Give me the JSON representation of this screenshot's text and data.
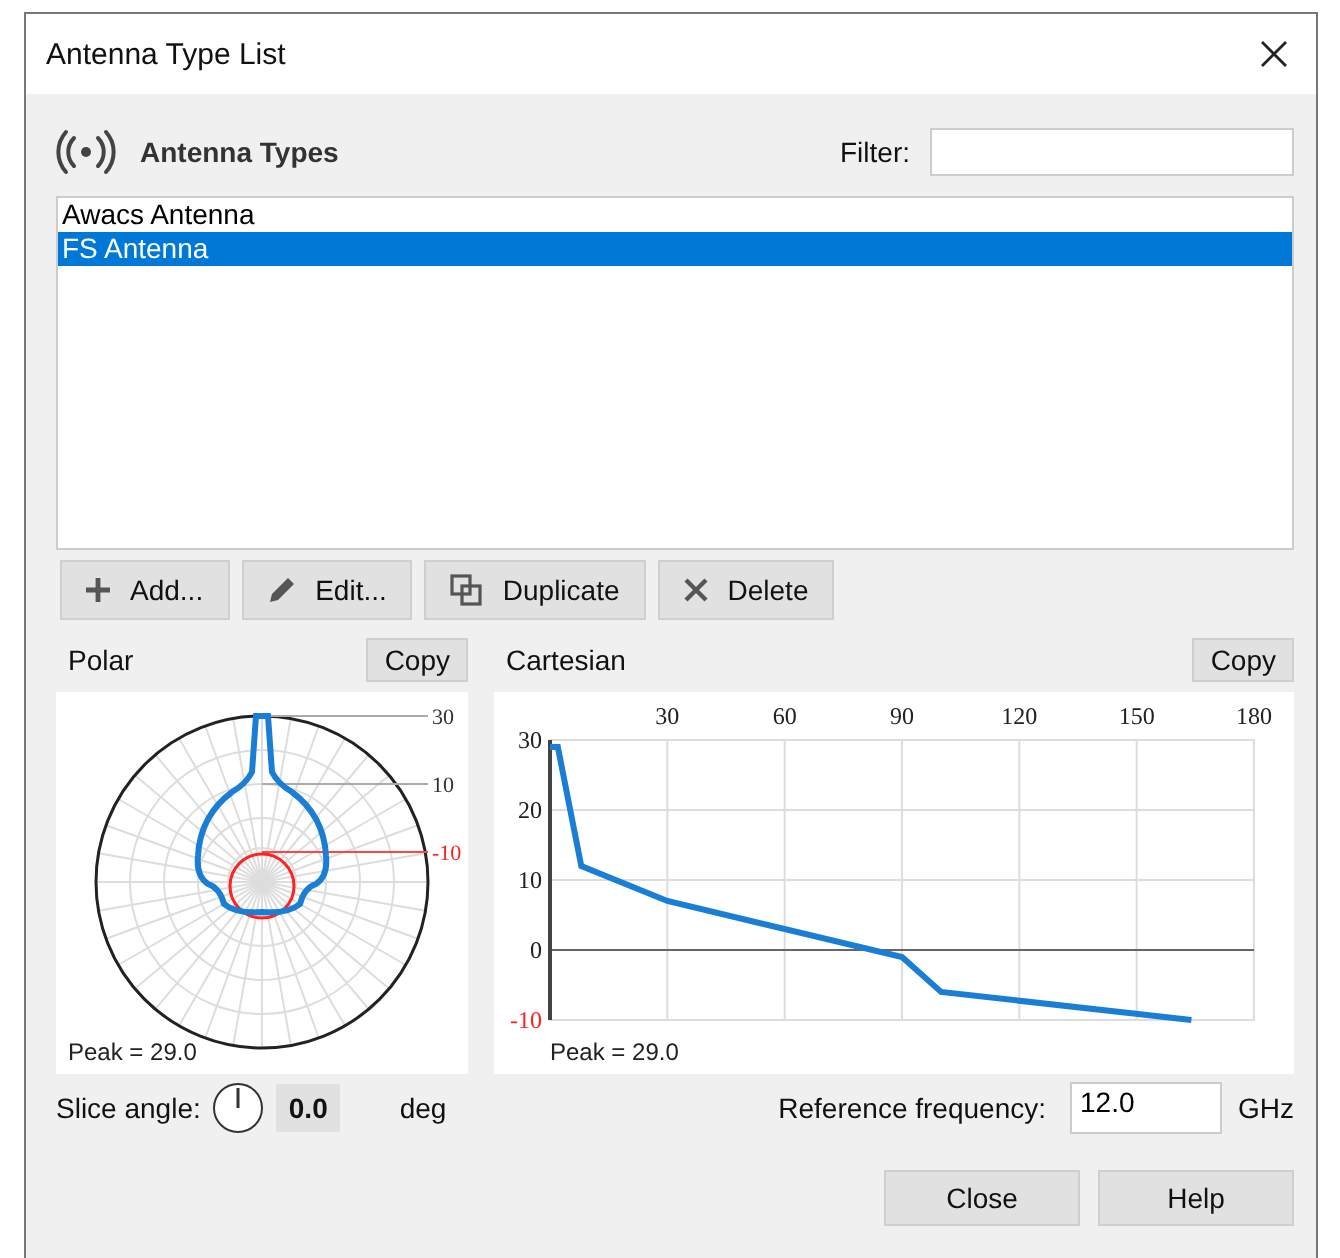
{
  "window": {
    "title": "Antenna Type List"
  },
  "header": {
    "title": "Antenna Types",
    "filter_label": "Filter:"
  },
  "antenna_list": [
    {
      "name": "Awacs Antenna",
      "selected": false
    },
    {
      "name": "FS Antenna",
      "selected": true
    }
  ],
  "toolbar": [
    {
      "label": "Add...",
      "kind": "add"
    },
    {
      "label": "Edit...",
      "kind": "edit"
    },
    {
      "label": "Duplicate",
      "kind": "duplicate"
    },
    {
      "label": "Delete",
      "kind": "delete"
    }
  ],
  "polar": {
    "title": "Polar",
    "copy_button": "Copy",
    "peak": "Peak = 29.0",
    "ring_labels": [
      {
        "text": "30",
        "kind": "outer"
      },
      {
        "text": "10",
        "kind": "mid"
      },
      {
        "text": "-10",
        "kind": "ref"
      }
    ]
  },
  "slice_angle": {
    "label": "Slice angle:",
    "value": "0.0",
    "unit": "deg"
  },
  "cartesian": {
    "title": "Cartesian",
    "copy_button": "Copy",
    "peak": "Peak = 29.0",
    "chart_data": {
      "type": "line",
      "x": [
        0,
        2,
        8,
        30,
        90,
        100,
        164
      ],
      "series": [
        {
          "color": "#1a7fd4",
          "values": [
            29,
            29,
            12,
            7,
            -1,
            -6,
            -10
          ]
        }
      ],
      "grid": true,
      "xlim": [
        0,
        180
      ],
      "ylim": [
        -10,
        30
      ],
      "xticks": [
        30,
        60,
        90,
        120,
        150,
        180
      ],
      "yticks": [
        30,
        20,
        10,
        0,
        -10
      ]
    }
  },
  "reference_frequency": {
    "label": "Reference frequency:",
    "value": "12.0",
    "unit": "GHz"
  },
  "buttons": [
    "Close",
    "Help"
  ]
}
